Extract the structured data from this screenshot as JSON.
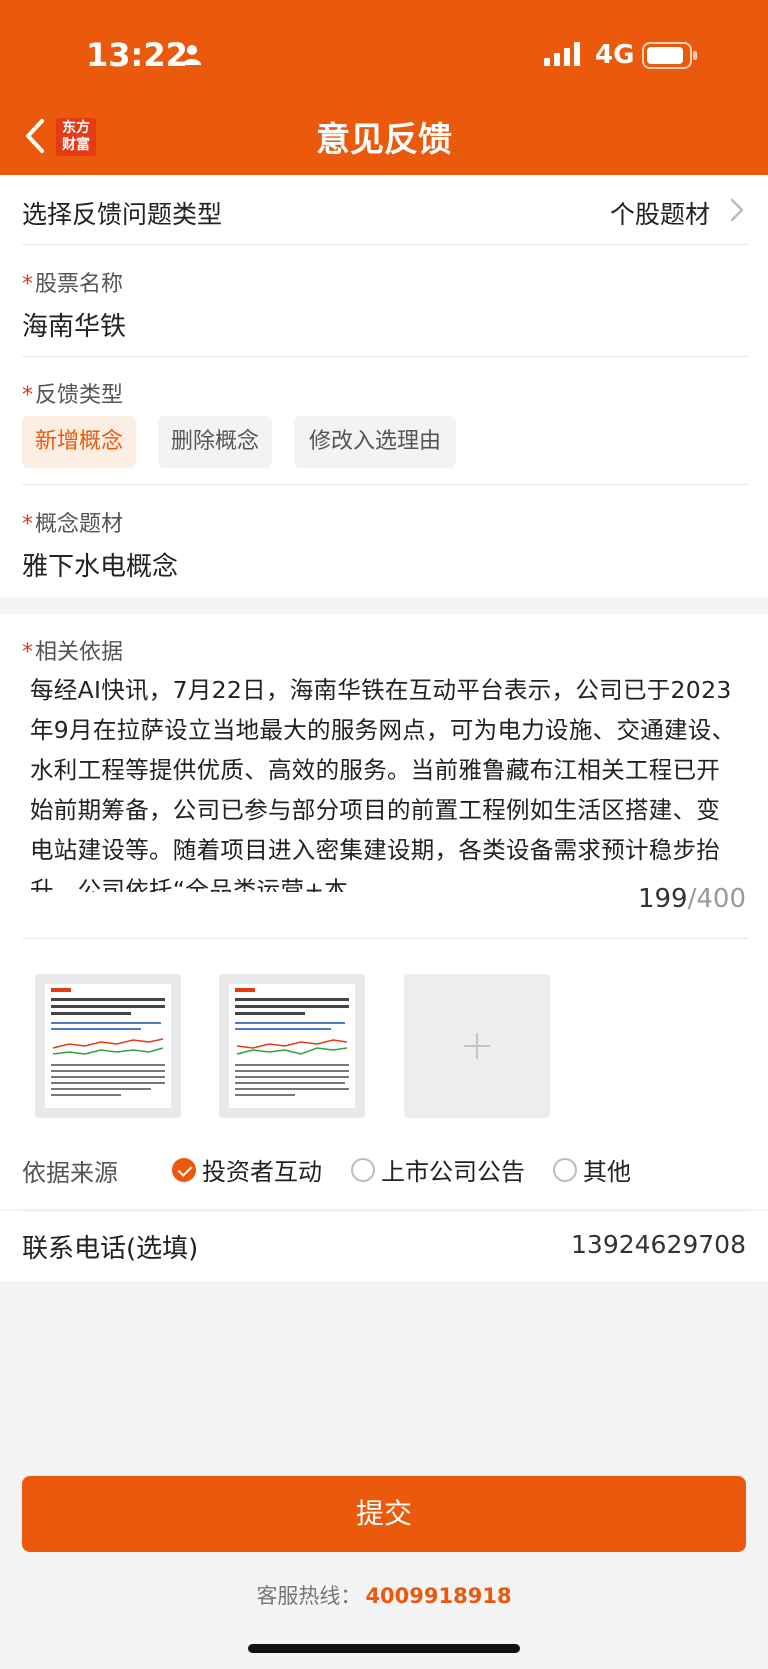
{
  "status_bar": {
    "time": "13:22",
    "network": "4G"
  },
  "nav": {
    "title": "意见反馈",
    "brand_line1": "东方",
    "brand_line2": "财富"
  },
  "issue_type": {
    "label": "选择反馈问题类型",
    "value": "个股题材"
  },
  "stock": {
    "label": "股票名称",
    "value": "海南华铁"
  },
  "feedback_type": {
    "label": "反馈类型",
    "options": [
      "新增概念",
      "删除概念",
      "修改入选理由"
    ],
    "selected": "新增概念"
  },
  "concept": {
    "label": "概念题材",
    "value": "雅下水电概念"
  },
  "basis": {
    "label": "相关依据",
    "text": "每经AI快讯，7月22日，海南华铁在互动平台表示，公司已于2023年9月在拉萨设立当地最大的服务网点，可为电力设施、交通建设、水利工程等提供优质、高效的服务。当前雅鲁藏布江相关工程已开始前期筹备，公司已参与部分项目的前置工程例如生活区搭建、变电站建设等。随着项目进入密集建设期，各类设备需求预计稳步抬升，公司依托“全品类运营+本",
    "count": "199",
    "max": "/400"
  },
  "source": {
    "label": "依据来源",
    "options": [
      "投资者互动",
      "上市公司公告",
      "其他"
    ],
    "selected": "投资者互动"
  },
  "phone": {
    "label": "联系电话(选填)",
    "value": "13924629708"
  },
  "submit_label": "提交",
  "hotline": {
    "label": "客服热线：",
    "number": "4009918918"
  },
  "colors": {
    "accent": "#eb5a0c",
    "required": "#e23a1a"
  }
}
